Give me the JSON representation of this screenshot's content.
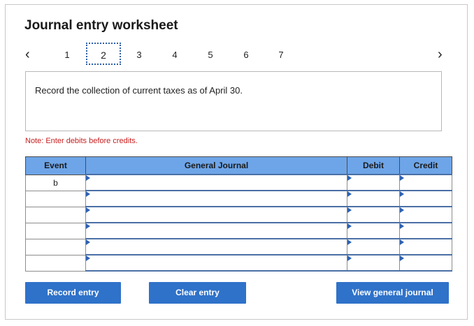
{
  "title": "Journal entry worksheet",
  "nav": {
    "prev_icon": "chevron-left-icon",
    "next_icon": "chevron-right-icon",
    "pages": [
      "1",
      "2",
      "3",
      "4",
      "5",
      "6",
      "7"
    ],
    "active_page": "2"
  },
  "prompt": "Record the collection of current taxes as of April 30.",
  "note": "Note: Enter debits before credits.",
  "table": {
    "headers": {
      "event": "Event",
      "general_journal": "General Journal",
      "debit": "Debit",
      "credit": "Credit"
    },
    "rows": [
      {
        "event": "b",
        "account": "",
        "debit": "",
        "credit": ""
      },
      {
        "event": "",
        "account": "",
        "debit": "",
        "credit": ""
      },
      {
        "event": "",
        "account": "",
        "debit": "",
        "credit": ""
      },
      {
        "event": "",
        "account": "",
        "debit": "",
        "credit": ""
      },
      {
        "event": "",
        "account": "",
        "debit": "",
        "credit": ""
      },
      {
        "event": "",
        "account": "",
        "debit": "",
        "credit": ""
      }
    ]
  },
  "buttons": {
    "record": "Record entry",
    "clear": "Clear entry",
    "view": "View general journal"
  },
  "colors": {
    "header_bg": "#6ea5e8",
    "button_bg": "#2f72c9",
    "note_text": "#c81e1e"
  }
}
